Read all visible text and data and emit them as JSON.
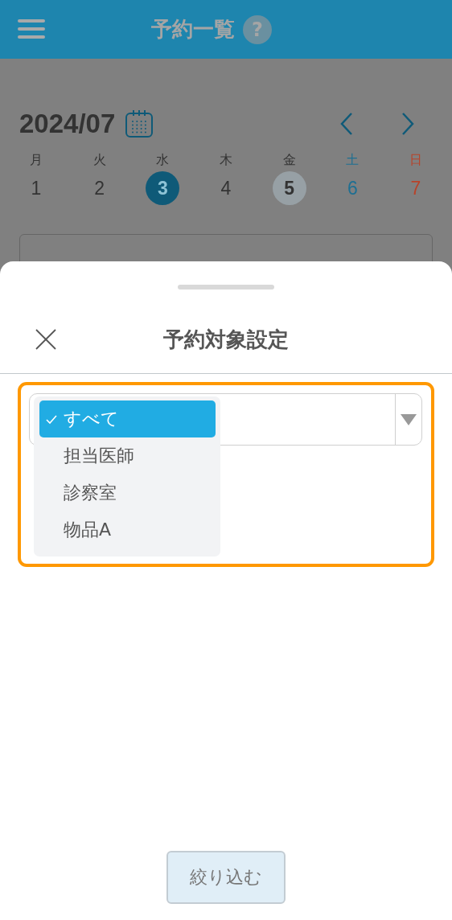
{
  "header": {
    "title": "予約一覧",
    "help": "?"
  },
  "calendar": {
    "month": "2024/07",
    "days": [
      {
        "weekday": "月",
        "date": "1",
        "kind": "weekday",
        "selected": false,
        "today": false
      },
      {
        "weekday": "火",
        "date": "2",
        "kind": "weekday",
        "selected": false,
        "today": false
      },
      {
        "weekday": "水",
        "date": "3",
        "kind": "weekday",
        "selected": true,
        "today": false
      },
      {
        "weekday": "木",
        "date": "4",
        "kind": "weekday",
        "selected": false,
        "today": false
      },
      {
        "weekday": "金",
        "date": "5",
        "kind": "weekday",
        "selected": false,
        "today": true
      },
      {
        "weekday": "土",
        "date": "6",
        "kind": "saturday",
        "selected": false,
        "today": false
      },
      {
        "weekday": "日",
        "date": "7",
        "kind": "sunday",
        "selected": false,
        "today": false
      }
    ]
  },
  "sheet": {
    "title": "予約対象設定",
    "options": [
      {
        "label": "すべて",
        "selected": true
      },
      {
        "label": "担当医師",
        "selected": false
      },
      {
        "label": "診察室",
        "selected": false
      },
      {
        "label": "物品A",
        "selected": false
      }
    ],
    "button": "絞り込む"
  }
}
